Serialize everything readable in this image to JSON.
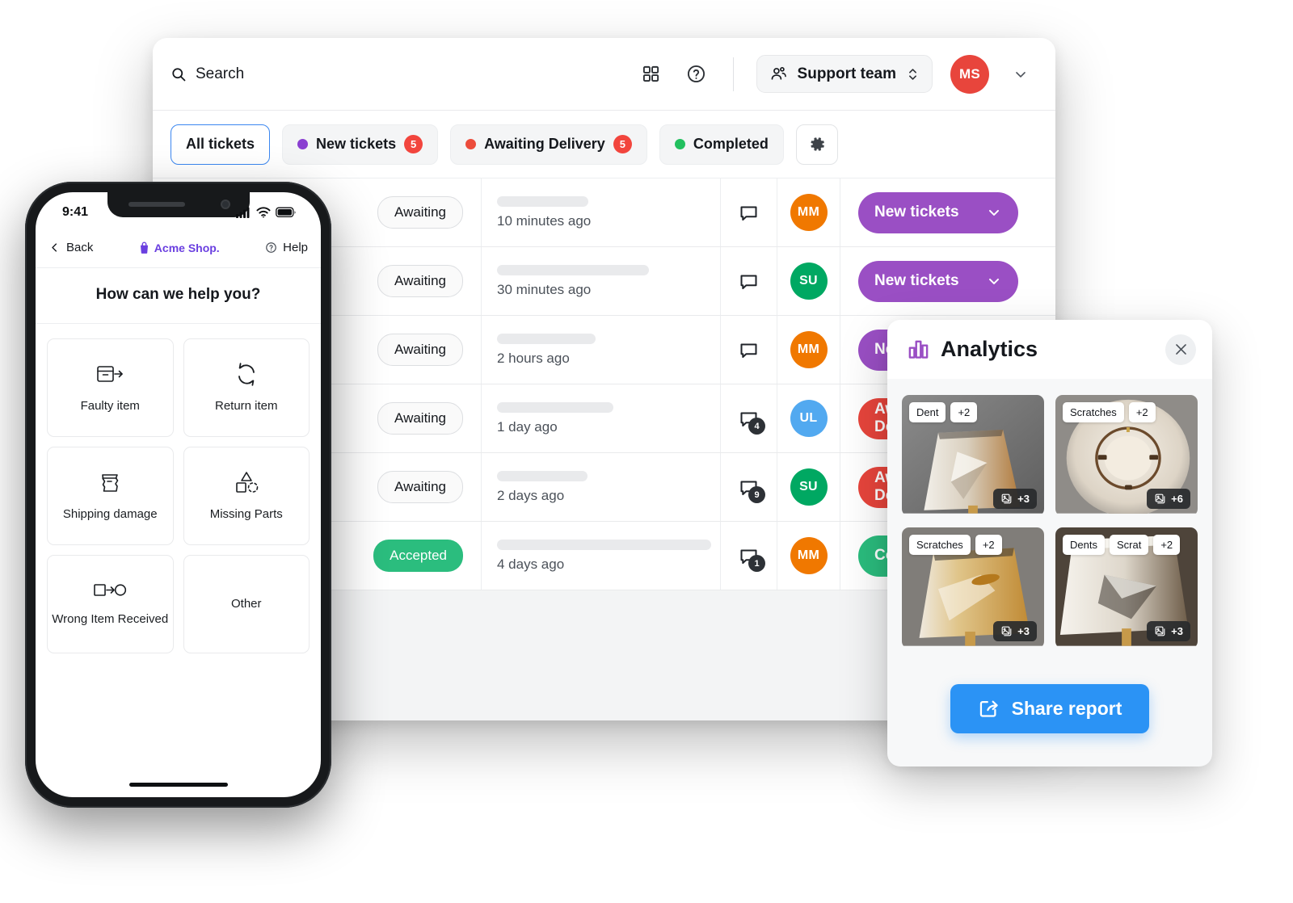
{
  "desktop": {
    "topbar": {
      "search_placeholder": "Search",
      "search_icon": "search-icon",
      "grid_icon": "grid-apps-icon",
      "help_icon": "help-circle-icon",
      "team_icon": "people-group-icon",
      "team_name": "Support team",
      "team_chevron_icon": "chevron-updown-icon",
      "avatar_initials": "MS",
      "avatar_color": "#e8453c",
      "user_chevron_icon": "chevron-down-icon"
    },
    "filters": [
      {
        "label": "All tickets",
        "dot": null,
        "count": null,
        "active": true
      },
      {
        "label": "New tickets",
        "dot": "#8a3fd1",
        "count": "5",
        "active": false
      },
      {
        "label": "Awaiting Delivery",
        "dot": "#ec4c3b",
        "count": "5",
        "active": false
      },
      {
        "label": "Completed",
        "dot": "#22c05f",
        "count": null,
        "active": false
      }
    ],
    "settings_icon": "gear-icon",
    "tickets": [
      {
        "state": "Awaiting",
        "state_kind": "awaiting",
        "skeleton_width": 113,
        "time": "10 minutes ago",
        "comment_icon": "comment-icon",
        "comment_count": null,
        "avatar": "MM",
        "avatar_color": "#f07800",
        "status_label": "New tickets",
        "status_color": "#9a4fc4",
        "status_chevron_icon": "chevron-down-icon"
      },
      {
        "state": "Awaiting",
        "state_kind": "awaiting",
        "skeleton_width": 188,
        "time": "30 minutes ago",
        "comment_icon": "comment-icon",
        "comment_count": null,
        "avatar": "SU",
        "avatar_color": "#00a862",
        "status_label": "New tickets",
        "status_color": "#9a4fc4",
        "status_chevron_icon": "chevron-down-icon"
      },
      {
        "state": "Awaiting",
        "state_kind": "awaiting",
        "skeleton_width": 122,
        "time": "2 hours ago",
        "comment_icon": "comment-icon",
        "comment_count": null,
        "avatar": "MM",
        "avatar_color": "#f07800",
        "status_label": "New tickets",
        "status_color": "#9a4fc4",
        "status_chevron_icon": "chevron-down-icon"
      },
      {
        "state": "Awaiting",
        "state_kind": "awaiting",
        "skeleton_width": 144,
        "time": "1 day ago",
        "comment_icon": "comment-icon",
        "comment_count": "4",
        "avatar": "UL",
        "avatar_color": "#52a9f0",
        "status_label": "Awaiting Delivery",
        "status_color": "#e8453c",
        "status_chevron_icon": "chevron-down-icon"
      },
      {
        "state": "Awaiting",
        "state_kind": "awaiting",
        "skeleton_width": 112,
        "time": "2 days ago",
        "comment_icon": "comment-icon",
        "comment_count": "9",
        "avatar": "SU",
        "avatar_color": "#00a862",
        "status_label": "Awaiting Delivery",
        "status_color": "#e8453c",
        "status_chevron_icon": "chevron-down-icon"
      },
      {
        "state": "Accepted",
        "state_kind": "accepted",
        "skeleton_width": 265,
        "time": "4 days ago",
        "comment_icon": "comment-icon",
        "comment_count": "1",
        "avatar": "MM",
        "avatar_color": "#f07800",
        "status_label": "Completed",
        "status_color": "#2bbd7e",
        "status_chevron_icon": "chevron-down-icon"
      }
    ]
  },
  "phone": {
    "status_time": "9:41",
    "signal_icon": "cellular-signal-icon",
    "wifi_icon": "wifi-icon",
    "battery_icon": "battery-icon",
    "back_label": "Back",
    "back_icon": "chevron-left-icon",
    "brand": "Acme Shop.",
    "brand_icon": "shopping-bag-icon",
    "brand_color": "#6a3fe0",
    "help_label": "Help",
    "help_icon": "help-circle-icon",
    "title": "How can we help you?",
    "options": [
      {
        "label": "Faulty item",
        "icon": "box-arrow-right-icon"
      },
      {
        "label": "Return item",
        "icon": "return-arrows-icon"
      },
      {
        "label": "Shipping damage",
        "icon": "crushed-box-icon"
      },
      {
        "label": "Missing Parts",
        "icon": "shapes-missing-icon"
      },
      {
        "label": "Wrong Item Received",
        "icon": "square-arrow-circle-icon"
      },
      {
        "label": "Other",
        "icon": null
      }
    ]
  },
  "analytics": {
    "title": "Analytics",
    "title_icon": "bar-chart-icon",
    "title_icon_color": "#9a4fc4",
    "close_icon": "close-x-icon",
    "cards": [
      {
        "tags": [
          "Dent",
          "+2"
        ],
        "image_count": "+3",
        "image_icon": "image-stack-icon",
        "variant": "dent-shade"
      },
      {
        "tags": [
          "Scratches",
          "+2"
        ],
        "image_count": "+6",
        "image_icon": "image-stack-icon",
        "variant": "top-ring"
      },
      {
        "tags": [
          "Scratches",
          "+2"
        ],
        "image_count": "+3",
        "image_icon": "image-stack-icon",
        "variant": "lit-shade"
      },
      {
        "tags": [
          "Dents",
          "Scrat",
          "+2"
        ],
        "image_count": "+3",
        "image_icon": "image-stack-icon",
        "variant": "dark-dent"
      }
    ],
    "share_label": "Share report",
    "share_icon": "share-arrow-icon",
    "share_color": "#2b93f5"
  }
}
